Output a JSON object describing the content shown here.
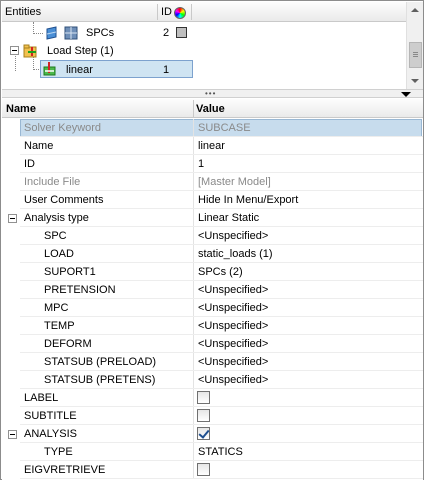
{
  "entities_panel": {
    "header": {
      "entities_label": "Entities",
      "id_label": "ID",
      "color_icon": "color-wheel-icon"
    },
    "items": [
      {
        "label": "SPCs",
        "id": "2",
        "icon": "spc-collector-icon",
        "swatch_color": "#bfbfbf"
      },
      {
        "label": "Load Step (1)",
        "id": "",
        "icon": "load-step-folder-icon"
      },
      {
        "label": "linear",
        "id": "1",
        "icon": "load-step-icon",
        "selected": true
      }
    ]
  },
  "splitter": {
    "grip": "•••"
  },
  "properties": {
    "header": {
      "name": "Name",
      "value": "Value"
    },
    "rows": [
      {
        "name": "Solver Keyword",
        "value": "SUBCASE",
        "gray": true,
        "highlight": true,
        "indent": 22
      },
      {
        "name": "Name",
        "value": "linear",
        "indent": 22
      },
      {
        "name": "ID",
        "value": "1",
        "indent": 22
      },
      {
        "name": "Include File",
        "value": "[Master Model]",
        "gray": true,
        "indent": 22
      },
      {
        "name": "User Comments",
        "value": "Hide In Menu/Export",
        "indent": 22
      },
      {
        "name": "Analysis type",
        "value": "Linear Static",
        "expander": true,
        "indent": 22
      },
      {
        "name": "SPC",
        "value": "<Unspecified>",
        "indent": 42
      },
      {
        "name": "LOAD",
        "value": "static_loads (1)",
        "indent": 42
      },
      {
        "name": "SUPORT1",
        "value": "SPCs (2)",
        "indent": 42
      },
      {
        "name": "PRETENSION",
        "value": "<Unspecified>",
        "indent": 42
      },
      {
        "name": "MPC",
        "value": "<Unspecified>",
        "indent": 42
      },
      {
        "name": "TEMP",
        "value": "<Unspecified>",
        "indent": 42
      },
      {
        "name": "DEFORM",
        "value": "<Unspecified>",
        "indent": 42
      },
      {
        "name": "STATSUB (PRELOAD)",
        "value": "<Unspecified>",
        "indent": 42
      },
      {
        "name": "STATSUB (PRETENS)",
        "value": "<Unspecified>",
        "indent": 42
      },
      {
        "name": "LABEL",
        "value": "",
        "checkbox": true,
        "checked": false,
        "indent": 22
      },
      {
        "name": "SUBTITLE",
        "value": "",
        "checkbox": true,
        "checked": false,
        "indent": 22
      },
      {
        "name": "ANALYSIS",
        "value": "",
        "checkbox": true,
        "checked": true,
        "expander": true,
        "indent": 22
      },
      {
        "name": "TYPE",
        "value": "STATICS",
        "indent": 42
      },
      {
        "name": "EIGVRETRIEVE",
        "value": "",
        "checkbox": true,
        "checked": false,
        "indent": 22
      }
    ]
  }
}
